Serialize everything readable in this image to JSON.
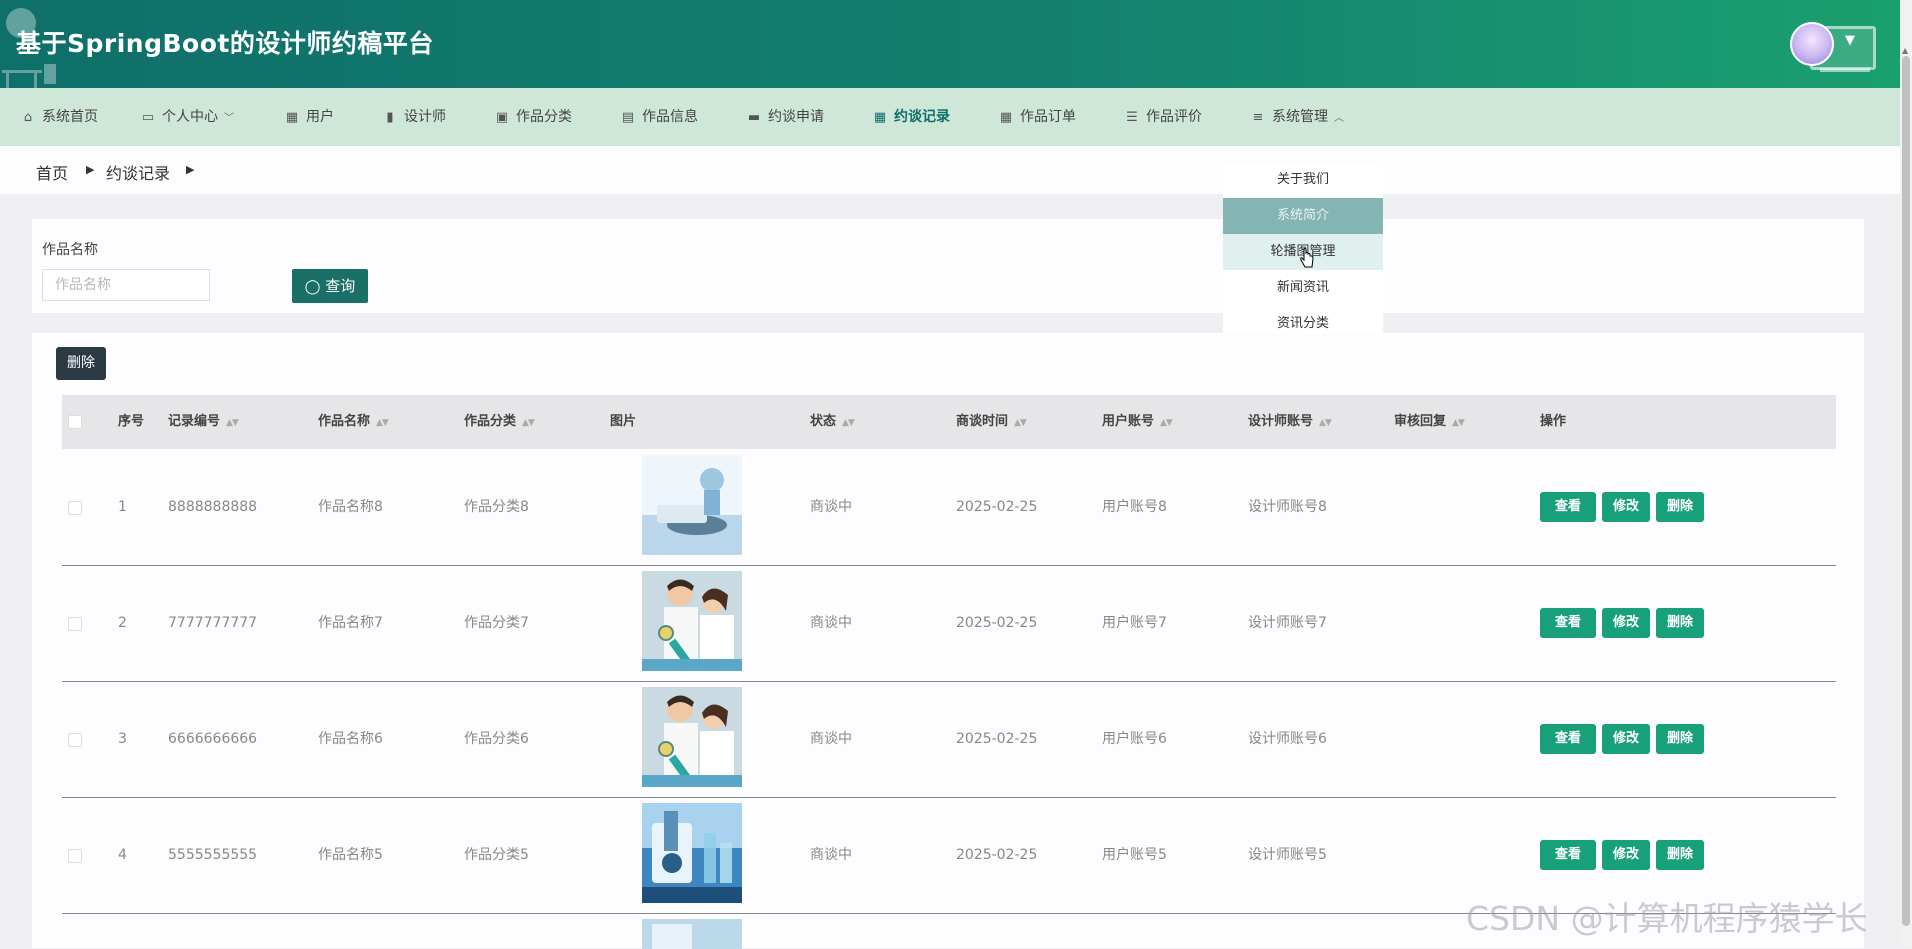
{
  "header": {
    "title": "基于SpringBoot的设计师约稿平台"
  },
  "nav": {
    "items": [
      {
        "label": "系统首页",
        "icon": "home-icon"
      },
      {
        "label": "个人中心",
        "icon": "wallet-icon",
        "caret": "﹀"
      },
      {
        "label": "用户",
        "icon": "grid-icon"
      },
      {
        "label": "设计师",
        "icon": "bar-chart-icon"
      },
      {
        "label": "作品分类",
        "icon": "briefcase-icon"
      },
      {
        "label": "作品信息",
        "icon": "clipboard-icon"
      },
      {
        "label": "约谈申请",
        "icon": "message-icon"
      },
      {
        "label": "约谈记录",
        "icon": "grid-icon",
        "active": true
      },
      {
        "label": "作品订单",
        "icon": "grid-icon"
      },
      {
        "label": "作品评价",
        "icon": "list-icon"
      },
      {
        "label": "系统管理",
        "icon": "sliders-icon",
        "caret": "︿"
      }
    ]
  },
  "breadcrumb": {
    "home": "首页",
    "current": "约谈记录"
  },
  "search": {
    "label": "作品名称",
    "placeholder": "作品名称",
    "button": "查询"
  },
  "toolbar": {
    "delete_label": "删除"
  },
  "table": {
    "columns": [
      "序号",
      "记录编号",
      "作品名称",
      "作品分类",
      "图片",
      "状态",
      "商谈时间",
      "用户账号",
      "设计师账号",
      "审核回复",
      "操作"
    ],
    "rows": [
      {
        "index": "1",
        "code": "8888888888",
        "name": "作品名称8",
        "category": "作品分类8",
        "status": "商谈中",
        "time": "2025-02-25",
        "user": "用户账号8",
        "designer": "设计师账号8",
        "reply": ""
      },
      {
        "index": "2",
        "code": "7777777777",
        "name": "作品名称7",
        "category": "作品分类7",
        "status": "商谈中",
        "time": "2025-02-25",
        "user": "用户账号7",
        "designer": "设计师账号7",
        "reply": ""
      },
      {
        "index": "3",
        "code": "6666666666",
        "name": "作品名称6",
        "category": "作品分类6",
        "status": "商谈中",
        "time": "2025-02-25",
        "user": "用户账号6",
        "designer": "设计师账号6",
        "reply": ""
      },
      {
        "index": "4",
        "code": "5555555555",
        "name": "作品名称5",
        "category": "作品分类5",
        "status": "商谈中",
        "time": "2025-02-25",
        "user": "用户账号5",
        "designer": "设计师账号5",
        "reply": ""
      }
    ],
    "actions": {
      "view": "查看",
      "edit": "修改",
      "delete": "删除"
    }
  },
  "dropdown": {
    "items": [
      "关于我们",
      "系统简介",
      "轮播图管理",
      "新闻资讯",
      "资讯分类"
    ]
  },
  "watermark": "CSDN @计算机程序猿学长",
  "colors": {
    "header": "#0f6f6a",
    "nav_bg": "#cfe7d9",
    "accent": "#17a07a",
    "delete_dark": "#2c3a44"
  }
}
